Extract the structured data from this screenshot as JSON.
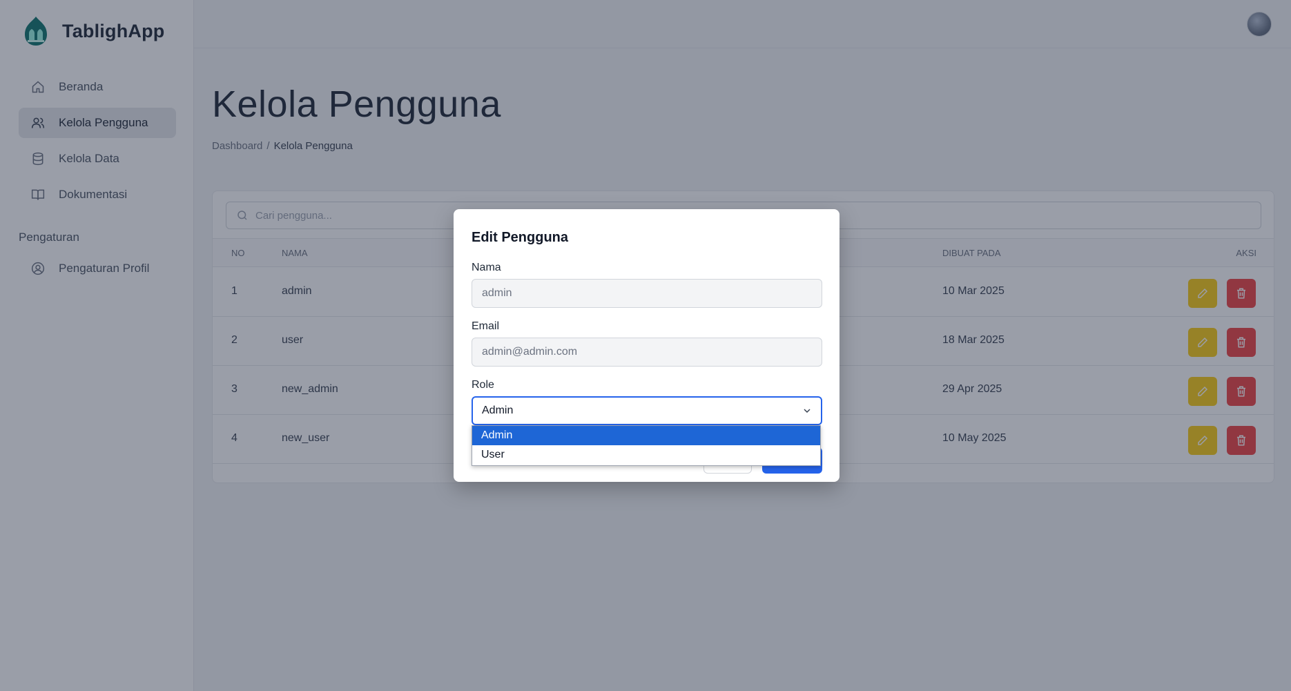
{
  "app": {
    "name": "TablighApp"
  },
  "sidebar": {
    "items": [
      {
        "label": "Beranda",
        "icon": "home-icon"
      },
      {
        "label": "Kelola Pengguna",
        "icon": "users-icon",
        "active": true
      },
      {
        "label": "Kelola Data",
        "icon": "database-icon"
      },
      {
        "label": "Dokumentasi",
        "icon": "book-icon"
      }
    ],
    "section_label": "Pengaturan",
    "settings_items": [
      {
        "label": "Pengaturan Profil",
        "icon": "user-circle-icon"
      }
    ]
  },
  "page": {
    "title": "Kelola Pengguna",
    "breadcrumb": {
      "root": "Dashboard",
      "separator": "/",
      "current": "Kelola Pengguna"
    }
  },
  "search": {
    "placeholder": "Cari pengguna..."
  },
  "table": {
    "headers": {
      "no": "NO",
      "nama": "NAMA",
      "dibuat_pada": "DIBUAT PADA",
      "aksi": "AKSI"
    },
    "rows": [
      {
        "no": "1",
        "nama": "admin",
        "dibuat_pada": "10 Mar 2025"
      },
      {
        "no": "2",
        "nama": "user",
        "dibuat_pada": "18 Mar 2025"
      },
      {
        "no": "3",
        "nama": "new_admin",
        "dibuat_pada": "29 Apr 2025"
      },
      {
        "no": "4",
        "nama": "new_user",
        "dibuat_pada": "10 May 2025"
      }
    ]
  },
  "modal": {
    "title": "Edit Pengguna",
    "nama_label": "Nama",
    "nama_value": "admin",
    "email_label": "Email",
    "email_value": "admin@admin.com",
    "role_label": "Role",
    "role_value": "Admin",
    "role_options": [
      "Admin",
      "User"
    ]
  },
  "colors": {
    "accent": "#2563eb",
    "edit": "#facc15",
    "delete": "#ef4444",
    "selected_option": "#1e66d6"
  }
}
